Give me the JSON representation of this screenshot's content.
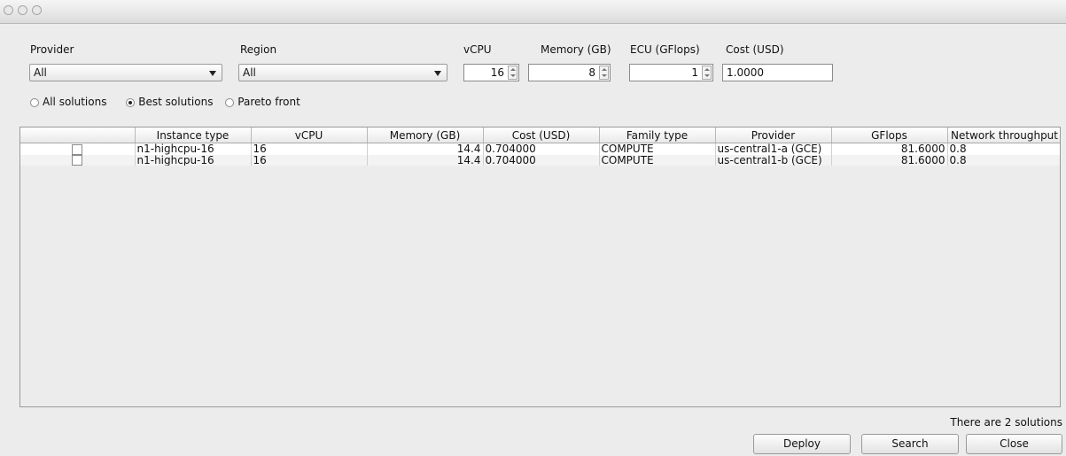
{
  "filters": {
    "provider_label": "Provider",
    "provider_value": "All",
    "region_label": "Region",
    "region_value": "All",
    "vcpu_label": "vCPU",
    "vcpu_value": "16",
    "memory_label": "Memory (GB)",
    "memory_value": "8",
    "ecu_label": "ECU (GFlops)",
    "ecu_value": "1",
    "cost_label": "Cost (USD)",
    "cost_value": "1.0000"
  },
  "modes": {
    "all": "All solutions",
    "best": "Best solutions",
    "pareto": "Pareto front",
    "selected": "best"
  },
  "table": {
    "columns": [
      "",
      "Instance type",
      "vCPU",
      "Memory (GB)",
      "Cost (USD)",
      "Family type",
      "Provider",
      "GFlops",
      "Network throughput"
    ],
    "rows": [
      {
        "checked": false,
        "instance_type": "n1-highcpu-16",
        "vcpu": "16",
        "memory": "14.4",
        "cost": "0.704000",
        "family": "COMPUTE",
        "provider": "us-central1-a (GCE)",
        "gflops": "81.6000",
        "network": "0.8"
      },
      {
        "checked": false,
        "instance_type": "n1-highcpu-16",
        "vcpu": "16",
        "memory": "14.4",
        "cost": "0.704000",
        "family": "COMPUTE",
        "provider": "us-central1-b (GCE)",
        "gflops": "81.6000",
        "network": "0.8"
      }
    ]
  },
  "status": "There are 2 solutions",
  "buttons": {
    "deploy": "Deploy",
    "search": "Search",
    "close": "Close"
  }
}
